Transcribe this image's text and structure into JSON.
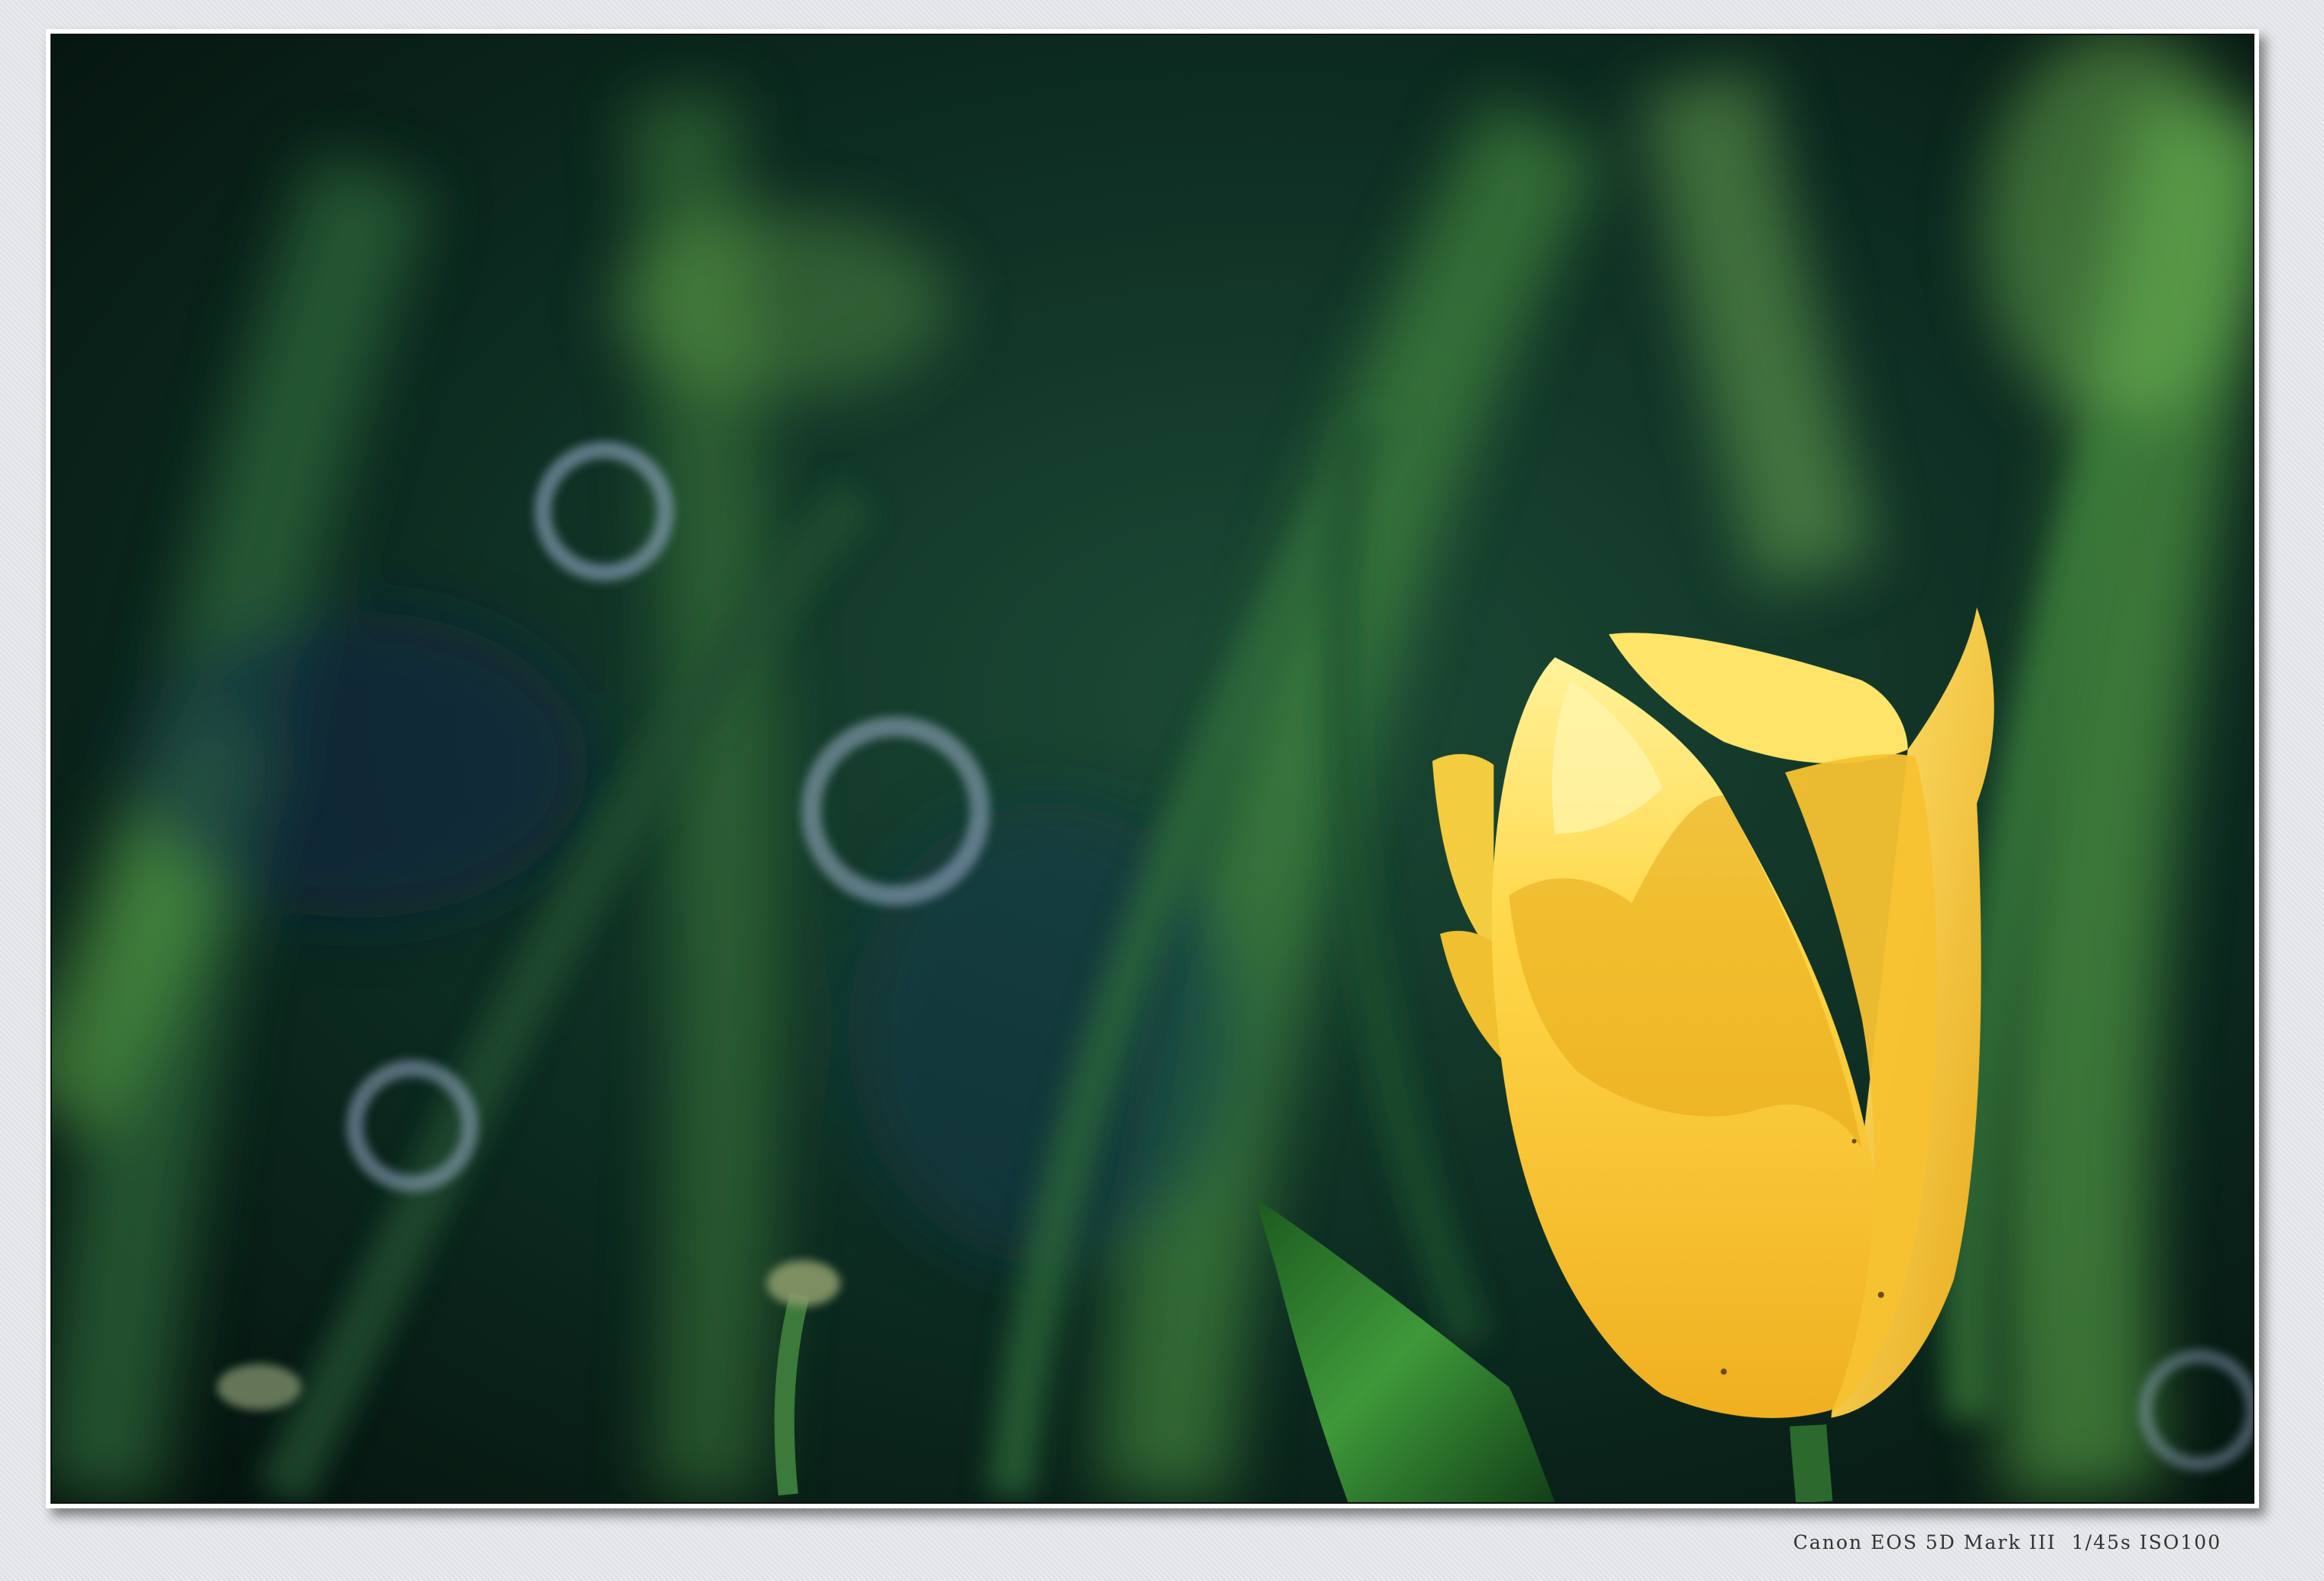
{
  "photo": {
    "subject": "yellow tulip",
    "palette": {
      "background_dark": "#06140f",
      "foliage": "#2f6b3a",
      "foliage_light": "#7fbf5a",
      "petal": "#f4c430",
      "petal_light": "#fff3a0",
      "leaf": "#2e7d32",
      "bokeh": "#9fb4d6"
    }
  },
  "caption": {
    "text": "Canon EOS 5D Mark III  1/45s ISO100"
  }
}
